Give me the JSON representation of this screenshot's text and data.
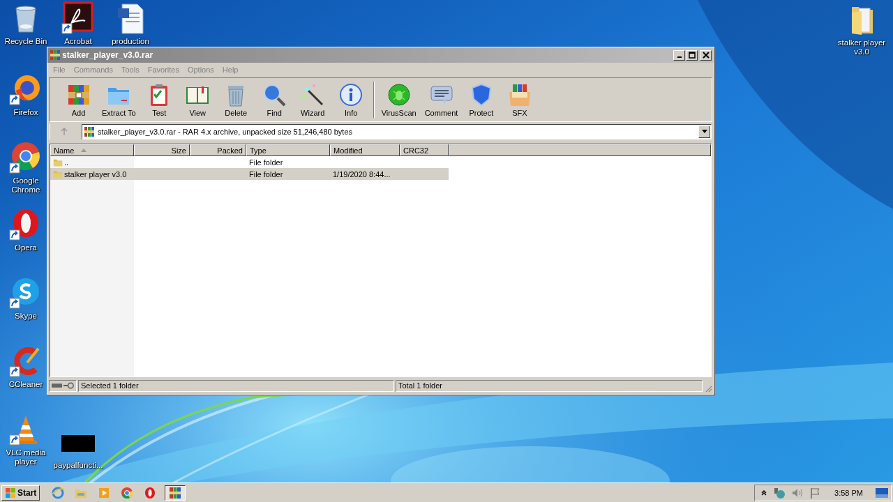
{
  "desktop_icons": [
    {
      "label": "Recycle Bin",
      "kind": "recycle",
      "shortcut": false
    },
    {
      "label": "Acrobat",
      "kind": "acrobat",
      "shortcut": true
    },
    {
      "label": "production",
      "kind": "word",
      "shortcut": false
    },
    {
      "label": "Firefox",
      "kind": "firefox",
      "shortcut": true
    },
    {
      "label": "Google Chrome",
      "kind": "chrome",
      "shortcut": true
    },
    {
      "label": "Opera",
      "kind": "opera",
      "shortcut": true
    },
    {
      "label": "Skype",
      "kind": "skype",
      "shortcut": true
    },
    {
      "label": "CCleaner",
      "kind": "ccleaner",
      "shortcut": true
    },
    {
      "label": "VLC media player",
      "kind": "vlc",
      "shortcut": true
    },
    {
      "label": "paypalfuncti...",
      "kind": "blank",
      "shortcut": false
    },
    {
      "label": "stalker player v3.0",
      "kind": "folder",
      "shortcut": false
    }
  ],
  "window": {
    "title": "stalker_player_v3.0.rar",
    "menu": [
      "File",
      "Commands",
      "Tools",
      "Favorites",
      "Options",
      "Help"
    ],
    "toolbar_groups": [
      [
        {
          "label": "Add",
          "kind": "add"
        },
        {
          "label": "Extract To",
          "kind": "extract"
        },
        {
          "label": "Test",
          "kind": "test"
        },
        {
          "label": "View",
          "kind": "view"
        },
        {
          "label": "Delete",
          "kind": "delete"
        },
        {
          "label": "Find",
          "kind": "find"
        },
        {
          "label": "Wizard",
          "kind": "wizard"
        },
        {
          "label": "Info",
          "kind": "info"
        }
      ],
      [
        {
          "label": "VirusScan",
          "kind": "virus"
        },
        {
          "label": "Comment",
          "kind": "comment"
        },
        {
          "label": "Protect",
          "kind": "protect"
        },
        {
          "label": "SFX",
          "kind": "sfx"
        }
      ]
    ],
    "address": "stalker_player_v3.0.rar - RAR 4.x archive, unpacked size 51,246,480 bytes",
    "columns": [
      {
        "label": "Name",
        "sorted": true
      },
      {
        "label": "Size",
        "sorted": false
      },
      {
        "label": "Packed",
        "sorted": false
      },
      {
        "label": "Type",
        "sorted": false
      },
      {
        "label": "Modified",
        "sorted": false
      },
      {
        "label": "CRC32",
        "sorted": false
      }
    ],
    "rows": [
      {
        "name": "..",
        "type": "File folder",
        "selected": false
      },
      {
        "name": "stalker player v3.0",
        "type": "File folder",
        "modified": "1/19/2020 8:44...",
        "selected": true
      }
    ],
    "status_left": "Selected 1 folder",
    "status_right": "Total 1 folder"
  },
  "taskbar": {
    "start": "Start",
    "apps": [
      {
        "kind": "ie",
        "active": false
      },
      {
        "kind": "explorer",
        "active": false
      },
      {
        "kind": "media",
        "active": false
      },
      {
        "kind": "chrome",
        "active": false
      },
      {
        "kind": "opera",
        "active": false
      },
      {
        "kind": "winrar",
        "active": true
      }
    ],
    "clock": "3:58 PM"
  }
}
